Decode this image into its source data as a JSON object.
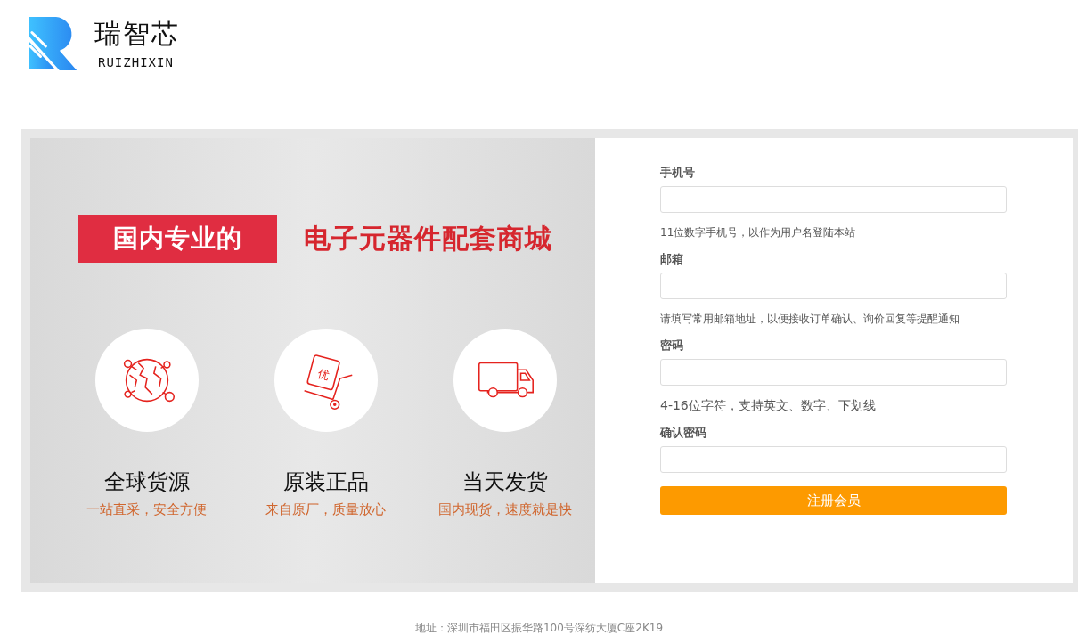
{
  "logo": {
    "name": "瑞智芯",
    "pinyin": "RUIZHIXIN"
  },
  "banner": {
    "tag": "国内专业的",
    "headline": "电子元器件配套商城",
    "features": [
      {
        "kind": "globe",
        "title": "全球货源",
        "subtitle": "一站直采，安全方便"
      },
      {
        "kind": "cart",
        "title": "原装正品",
        "subtitle": "来自原厂，质量放心",
        "badge": "优"
      },
      {
        "kind": "truck",
        "title": "当天发货",
        "subtitle": "国内现货，速度就是快"
      }
    ]
  },
  "form": {
    "fields": [
      {
        "label": "手机号",
        "hint": "11位数字手机号，以作为用户名登陆本站"
      },
      {
        "label": "邮箱",
        "hint": "请填写常用邮箱地址，以便接收订单确认、询价回复等提醒通知"
      },
      {
        "label": "密码",
        "hint": "4-16位字符，支持英文、数字、下划线"
      },
      {
        "label": "确认密码"
      }
    ],
    "submit": "注册会员"
  },
  "footer": "地址：深圳市福田区振华路100号深纺大厦C座2K19"
}
